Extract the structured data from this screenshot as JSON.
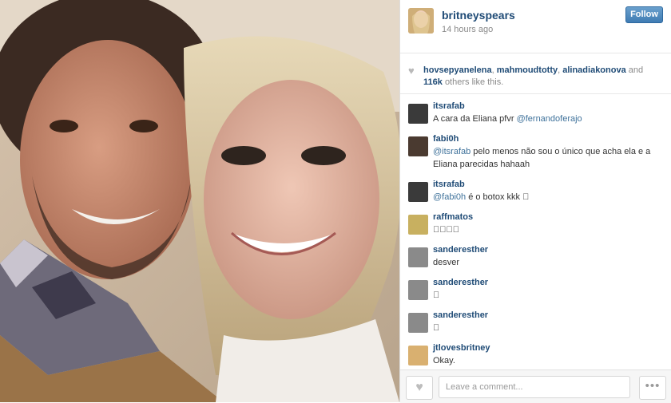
{
  "post": {
    "username": "britneyspears",
    "time": "14 hours ago",
    "follow_label": "Follow"
  },
  "likes": {
    "user1": "hovsepyanelena",
    "user2": "mahmoudtotty",
    "user3": "alinadiakonova",
    "and": "and",
    "count": "116k",
    "rest": "others like this."
  },
  "comments": [
    {
      "user": "itsrafab",
      "mention": "",
      "text": "A cara da Eliana pfvr ",
      "mention_after": "@fernandoferajo",
      "avatar_color": "#3a3a3a"
    },
    {
      "user": "fabi0h",
      "mention": "@itsrafab",
      "text": " pelo menos não sou o único que acha ela e a Eliana parecidas hahaah",
      "mention_after": "",
      "avatar_color": "#4a3a30"
    },
    {
      "user": "itsrafab",
      "mention": "@fabi0h",
      "text": " é o botox kkk 󾌴",
      "mention_after": "",
      "avatar_color": "#3a3a3a"
    },
    {
      "user": "raffmatos",
      "mention": "",
      "text": "󾌧󾌧󾌧󾌧",
      "mention_after": "",
      "avatar_color": "#c8b060"
    },
    {
      "user": "sanderesther",
      "mention": "",
      "text": "desver",
      "mention_after": "",
      "avatar_color": "#8a8a8a"
    },
    {
      "user": "sanderesther",
      "mention": "",
      "text": "󾌴",
      "mention_after": "",
      "avatar_color": "#8a8a8a"
    },
    {
      "user": "sanderesther",
      "mention": "",
      "text": "󾌴",
      "mention_after": "",
      "avatar_color": "#8a8a8a"
    },
    {
      "user": "jtlovesbritney",
      "mention": "",
      "text": "Okay.",
      "mention_after": "",
      "avatar_color": "#d9b070"
    }
  ],
  "footer": {
    "comment_placeholder": "Leave a comment...",
    "like_icon": "heart-icon",
    "more_icon": "ellipsis-icon",
    "more_label": "•••"
  },
  "colors": {
    "link": "#1f4b76",
    "follow": "#3f7bb3"
  }
}
